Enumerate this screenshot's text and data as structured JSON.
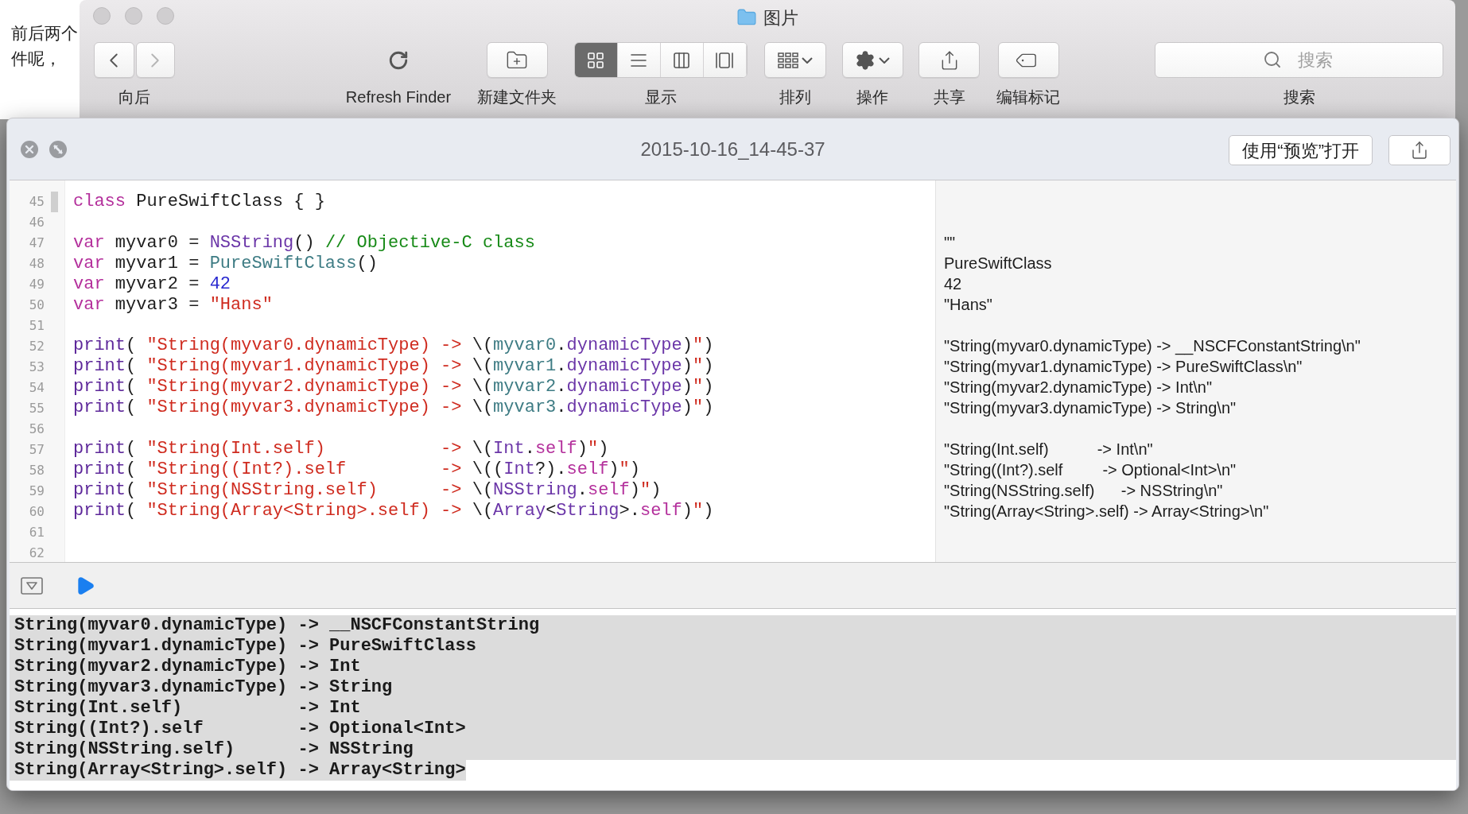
{
  "background_page": {
    "lines": [
      "前后两个",
      "件呢，"
    ]
  },
  "finder": {
    "title": "图片",
    "back_disabled": false,
    "forward_disabled": true,
    "toolbar": [
      {
        "kind": "nav",
        "label": "向后"
      },
      {
        "kind": "refresh",
        "label": "Refresh Finder"
      },
      {
        "kind": "new_folder",
        "label": "新建文件夹"
      },
      {
        "kind": "view",
        "label": "显示",
        "segments": [
          {
            "selected": true
          },
          {
            "selected": false
          },
          {
            "selected": false
          },
          {
            "selected": false
          }
        ]
      },
      {
        "kind": "arrange",
        "label": "排列"
      },
      {
        "kind": "action",
        "label": "操作"
      },
      {
        "kind": "share",
        "label": "共享"
      },
      {
        "kind": "tags",
        "label": "编辑标记"
      },
      {
        "kind": "search",
        "label": "搜索",
        "placeholder": "搜索"
      }
    ]
  },
  "quick_look": {
    "title": "2015-10-16_14-45-37",
    "open_button": "使用“预览”打开",
    "code_lines": [
      {
        "number": "45",
        "current": true,
        "tokens": [
          {
            "kind": "keyword",
            "text": "class"
          },
          {
            "kind": "plain",
            "text": " PureSwiftClass { }"
          }
        ]
      },
      {
        "number": "46",
        "current": false
      },
      {
        "number": "47",
        "current": false,
        "tokens": [
          {
            "kind": "keyword",
            "text": "var"
          },
          {
            "kind": "plain",
            "text": " myvar0 = "
          },
          {
            "kind": "lib",
            "text": "NSString"
          },
          {
            "kind": "plain",
            "text": "() "
          },
          {
            "kind": "comment",
            "text": "// Objective-C class"
          }
        ],
        "result": "\"\""
      },
      {
        "number": "48",
        "current": false,
        "tokens": [
          {
            "kind": "keyword",
            "text": "var"
          },
          {
            "kind": "plain",
            "text": " myvar1 = "
          },
          {
            "kind": "project",
            "text": "PureSwiftClass"
          },
          {
            "kind": "plain",
            "text": "()"
          }
        ],
        "result": "PureSwiftClass"
      },
      {
        "number": "49",
        "current": false,
        "tokens": [
          {
            "kind": "keyword",
            "text": "var"
          },
          {
            "kind": "plain",
            "text": " myvar2 = "
          },
          {
            "kind": "number",
            "text": "42"
          }
        ],
        "result": "42"
      },
      {
        "number": "50",
        "current": false,
        "tokens": [
          {
            "kind": "keyword",
            "text": "var"
          },
          {
            "kind": "plain",
            "text": " myvar3 = "
          },
          {
            "kind": "string",
            "text": "\"Hans\""
          }
        ],
        "result": "\"Hans\""
      },
      {
        "number": "51",
        "current": false
      },
      {
        "number": "52",
        "current": false,
        "tokens": [
          {
            "kind": "func",
            "text": "print"
          },
          {
            "kind": "plain",
            "text": "( "
          },
          {
            "kind": "string",
            "text": "\"String(myvar0.dynamicType) -> "
          },
          {
            "kind": "plain",
            "text": "\\("
          },
          {
            "kind": "project",
            "text": "myvar0"
          },
          {
            "kind": "plain",
            "text": "."
          },
          {
            "kind": "lib",
            "text": "dynamicType"
          },
          {
            "kind": "plain",
            "text": ")"
          },
          {
            "kind": "string",
            "text": "\""
          },
          {
            "kind": "plain",
            "text": ")"
          }
        ],
        "result": "\"String(myvar0.dynamicType) -> __NSCFConstantString\\n\""
      },
      {
        "number": "53",
        "current": false,
        "tokens": [
          {
            "kind": "func",
            "text": "print"
          },
          {
            "kind": "plain",
            "text": "( "
          },
          {
            "kind": "string",
            "text": "\"String(myvar1.dynamicType) -> "
          },
          {
            "kind": "plain",
            "text": "\\("
          },
          {
            "kind": "project",
            "text": "myvar1"
          },
          {
            "kind": "plain",
            "text": "."
          },
          {
            "kind": "lib",
            "text": "dynamicType"
          },
          {
            "kind": "plain",
            "text": ")"
          },
          {
            "kind": "string",
            "text": "\""
          },
          {
            "kind": "plain",
            "text": ")"
          }
        ],
        "result": "\"String(myvar1.dynamicType) -> PureSwiftClass\\n\""
      },
      {
        "number": "54",
        "current": false,
        "tokens": [
          {
            "kind": "func",
            "text": "print"
          },
          {
            "kind": "plain",
            "text": "( "
          },
          {
            "kind": "string",
            "text": "\"String(myvar2.dynamicType) -> "
          },
          {
            "kind": "plain",
            "text": "\\("
          },
          {
            "kind": "project",
            "text": "myvar2"
          },
          {
            "kind": "plain",
            "text": "."
          },
          {
            "kind": "lib",
            "text": "dynamicType"
          },
          {
            "kind": "plain",
            "text": ")"
          },
          {
            "kind": "string",
            "text": "\""
          },
          {
            "kind": "plain",
            "text": ")"
          }
        ],
        "result": "\"String(myvar2.dynamicType) -> Int\\n\""
      },
      {
        "number": "55",
        "current": false,
        "tokens": [
          {
            "kind": "func",
            "text": "print"
          },
          {
            "kind": "plain",
            "text": "( "
          },
          {
            "kind": "string",
            "text": "\"String(myvar3.dynamicType) -> "
          },
          {
            "kind": "plain",
            "text": "\\("
          },
          {
            "kind": "project",
            "text": "myvar3"
          },
          {
            "kind": "plain",
            "text": "."
          },
          {
            "kind": "lib",
            "text": "dynamicType"
          },
          {
            "kind": "plain",
            "text": ")"
          },
          {
            "kind": "string",
            "text": "\""
          },
          {
            "kind": "plain",
            "text": ")"
          }
        ],
        "result": "\"String(myvar3.dynamicType) -> String\\n\""
      },
      {
        "number": "56",
        "current": false
      },
      {
        "number": "57",
        "current": false,
        "tokens": [
          {
            "kind": "func",
            "text": "print"
          },
          {
            "kind": "plain",
            "text": "( "
          },
          {
            "kind": "string",
            "text": "\"String(Int.self)           -> "
          },
          {
            "kind": "plain",
            "text": "\\("
          },
          {
            "kind": "lib",
            "text": "Int"
          },
          {
            "kind": "plain",
            "text": "."
          },
          {
            "kind": "keyword",
            "text": "self"
          },
          {
            "kind": "plain",
            "text": ")"
          },
          {
            "kind": "string",
            "text": "\""
          },
          {
            "kind": "plain",
            "text": ")"
          }
        ],
        "result": "\"String(Int.self)           -> Int\\n\""
      },
      {
        "number": "58",
        "current": false,
        "tokens": [
          {
            "kind": "func",
            "text": "print"
          },
          {
            "kind": "plain",
            "text": "( "
          },
          {
            "kind": "string",
            "text": "\"String((Int?).self         -> "
          },
          {
            "kind": "plain",
            "text": "\\(("
          },
          {
            "kind": "lib",
            "text": "Int"
          },
          {
            "kind": "plain",
            "text": "?)."
          },
          {
            "kind": "keyword",
            "text": "self"
          },
          {
            "kind": "plain",
            "text": ")"
          },
          {
            "kind": "string",
            "text": "\""
          },
          {
            "kind": "plain",
            "text": ")"
          }
        ],
        "result": "\"String((Int?).self         -> Optional<Int>\\n\""
      },
      {
        "number": "59",
        "current": false,
        "tokens": [
          {
            "kind": "func",
            "text": "print"
          },
          {
            "kind": "plain",
            "text": "( "
          },
          {
            "kind": "string",
            "text": "\"String(NSString.self)      -> "
          },
          {
            "kind": "plain",
            "text": "\\("
          },
          {
            "kind": "lib",
            "text": "NSString"
          },
          {
            "kind": "plain",
            "text": "."
          },
          {
            "kind": "keyword",
            "text": "self"
          },
          {
            "kind": "plain",
            "text": ")"
          },
          {
            "kind": "string",
            "text": "\""
          },
          {
            "kind": "plain",
            "text": ")"
          }
        ],
        "result": "\"String(NSString.self)      -> NSString\\n\""
      },
      {
        "number": "60",
        "current": false,
        "tokens": [
          {
            "kind": "func",
            "text": "print"
          },
          {
            "kind": "plain",
            "text": "( "
          },
          {
            "kind": "string",
            "text": "\"String(Array<String>.self) -> "
          },
          {
            "kind": "plain",
            "text": "\\("
          },
          {
            "kind": "lib",
            "text": "Array"
          },
          {
            "kind": "plain",
            "text": "<"
          },
          {
            "kind": "lib",
            "text": "String"
          },
          {
            "kind": "plain",
            "text": ">."
          },
          {
            "kind": "keyword",
            "text": "self"
          },
          {
            "kind": "plain",
            "text": ")"
          },
          {
            "kind": "string",
            "text": "\""
          },
          {
            "kind": "plain",
            "text": ")"
          }
        ],
        "result": "\"String(Array<String>.self) -> Array<String>\\n\""
      },
      {
        "number": "61",
        "current": false
      },
      {
        "number": "62",
        "current": false
      }
    ],
    "console_lines": [
      "String(myvar0.dynamicType) -> __NSCFConstantString",
      "String(myvar1.dynamicType) -> PureSwiftClass",
      "String(myvar2.dynamicType) -> Int",
      "String(myvar3.dynamicType) -> String",
      "String(Int.self)           -> Int",
      "String((Int?).self         -> Optional<Int>",
      "String(NSString.self)      -> NSString",
      "String(Array<String>.self) -> Array<String>"
    ]
  }
}
